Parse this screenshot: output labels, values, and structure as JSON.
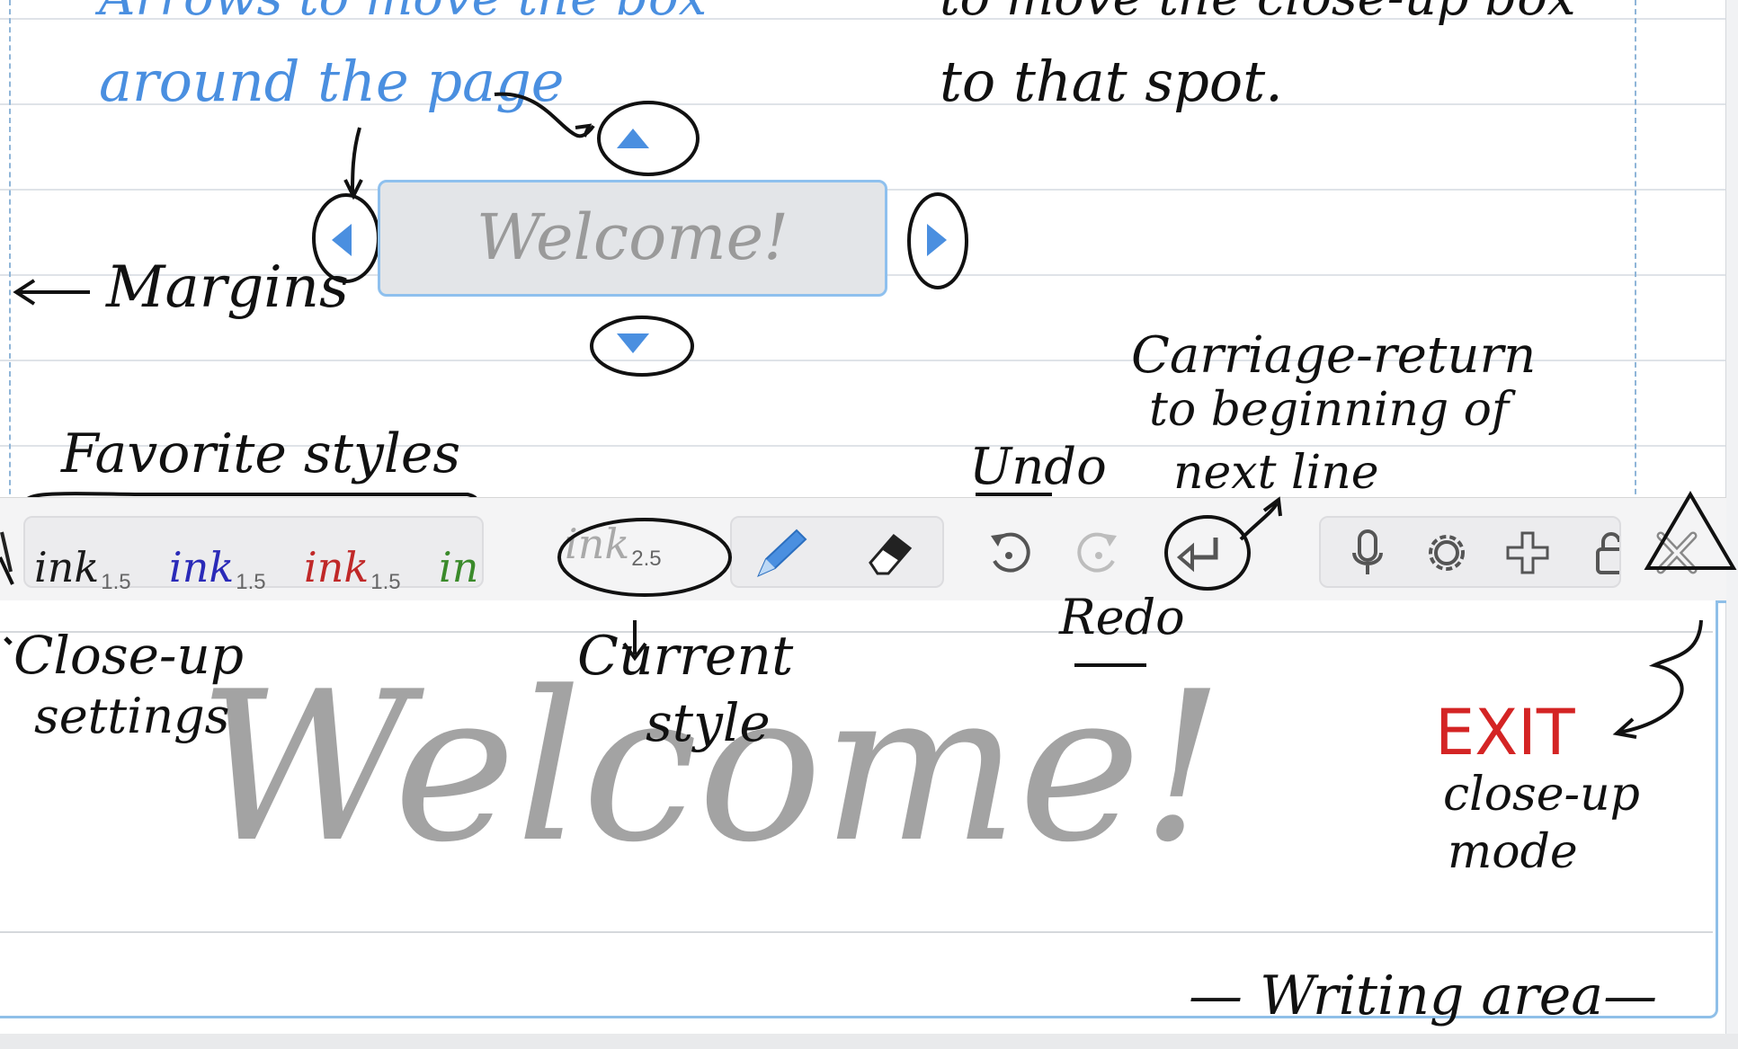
{
  "annotations": {
    "top_left_partial": "Arrows to move the box",
    "around_the_page": "around the page",
    "top_right_partial": "to move the close-up box",
    "to_that_spot": "to that spot.",
    "margins": "Margins",
    "favorite_styles": "Favorite styles",
    "undo": "Undo",
    "carriage_return": [
      "Carriage-return",
      "to beginning of",
      "next line"
    ],
    "close_up_settings": [
      "Close-up",
      "settings"
    ],
    "current_style": [
      "Current",
      "style"
    ],
    "redo": "Redo",
    "exit": "EXIT",
    "exit_desc": [
      "close-up",
      "mode"
    ],
    "writing_area": "— Writing area—"
  },
  "closeup_box": {
    "text": "Welcome!"
  },
  "toolbar": {
    "favorite_styles": [
      {
        "label": "ink",
        "size": "1.5",
        "color": "#1a1a1a"
      },
      {
        "label": "ink",
        "size": "1.5",
        "color": "#2a2ab8"
      },
      {
        "label": "ink",
        "size": "1.5",
        "color": "#c02828"
      },
      {
        "label": "in",
        "size": "",
        "color": "#3a8a2a"
      }
    ],
    "current_style": {
      "label": "ink",
      "size": "2.5",
      "color": "#a9a9a9"
    },
    "icons": {
      "pen": "pen-icon",
      "eraser": "eraser-icon",
      "undo": "undo-icon",
      "redo": "redo-icon",
      "return": "return-icon",
      "mic": "microphone-icon",
      "settings": "gear-icon",
      "add": "plus-icon",
      "lock": "lock-icon",
      "close": "close-icon",
      "settings_toggle": "settings-toggle-icon"
    }
  },
  "writing_area": {
    "text": "Welcome!"
  },
  "colors": {
    "accent": "#4a8fe0",
    "exit": "#d42424",
    "ink_gray": "#a3a3a3"
  }
}
